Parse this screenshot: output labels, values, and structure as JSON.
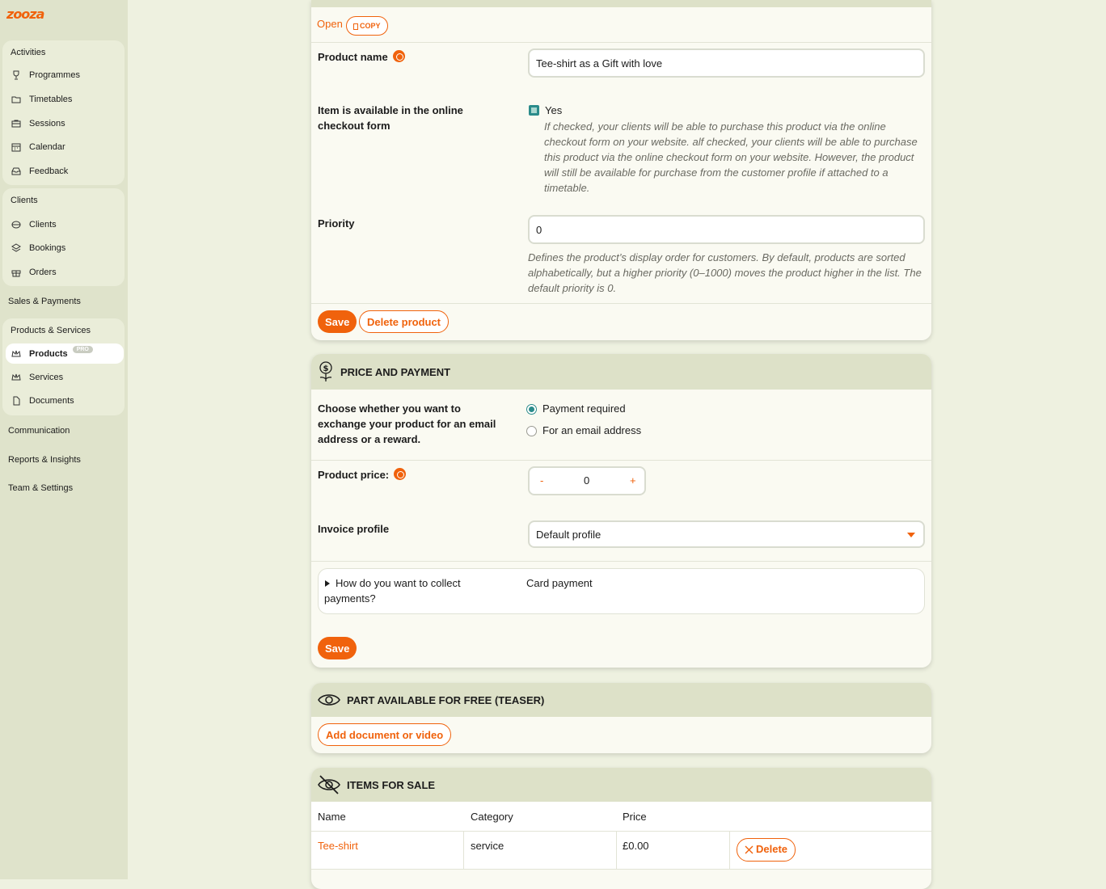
{
  "brand": {
    "logo_text": "zooza",
    "accent": "#f0620c"
  },
  "sidebar": {
    "groups": [
      {
        "heading": "Activities",
        "items": [
          {
            "label": "Programmes",
            "icon": "trophy-icon"
          },
          {
            "label": "Timetables",
            "icon": "folder-icon"
          },
          {
            "label": "Sessions",
            "icon": "briefcase-icon"
          },
          {
            "label": "Calendar",
            "icon": "calendar-icon"
          },
          {
            "label": "Feedback",
            "icon": "inbox-icon"
          }
        ]
      },
      {
        "heading": "Clients",
        "items": [
          {
            "label": "Clients",
            "icon": "users-icon"
          },
          {
            "label": "Bookings",
            "icon": "layers-icon"
          },
          {
            "label": "Orders",
            "icon": "gift-icon"
          }
        ]
      },
      {
        "heading": "Products & Services",
        "items": [
          {
            "label": "Products",
            "icon": "crown-icon",
            "active": true,
            "badge": "PRO"
          },
          {
            "label": "Services",
            "icon": "crown-icon"
          },
          {
            "label": "Documents",
            "icon": "document-icon"
          }
        ]
      }
    ],
    "standalone": [
      "Sales & Payments",
      "Communication",
      "Reports & Insights",
      "Team & Settings"
    ]
  },
  "product_card": {
    "open_label": "Open",
    "copy_label": "COPY",
    "product_name_label": "Product name",
    "product_name_value": "Tee-shirt as a Gift with love",
    "online_label": "Item is available in the online checkout form",
    "online_checked_label": "Yes",
    "online_help": "If checked, your clients will be able to purchase this product via the online checkout form on your website. alf checked, your clients will be able to purchase this product via the online checkout form on your website. However, the product will still be available for purchase from the customer profile if attached to a timetable.",
    "priority_label": "Priority",
    "priority_value": "0",
    "priority_help": "Defines the product’s display order for customers. By default, products are sorted alphabetically, but a higher priority (0–1000) moves the product higher in the list. The default priority is 0.",
    "save_label": "Save",
    "delete_label": "Delete product"
  },
  "price_card": {
    "title": "PRICE AND PAYMENT",
    "exchange_label": "Choose whether you want to exchange your product for an email address or a reward.",
    "options": [
      "Payment required",
      "For an email address"
    ],
    "selected_option": "Payment required",
    "price_label": "Product price:",
    "price_minus": "-",
    "price_value": "0",
    "price_plus": "+",
    "invoice_label": "Invoice profile",
    "invoice_value": "Default profile",
    "collect_label": "How do you want to collect payments?",
    "collect_value": "Card payment",
    "save_label": "Save"
  },
  "teaser_card": {
    "title": "PART AVAILABLE FOR FREE (TEASER)",
    "add_label": "Add document or video"
  },
  "items_card": {
    "title": "ITEMS FOR SALE",
    "columns": [
      "Name",
      "Category",
      "Price"
    ],
    "rows": [
      {
        "name": "Tee-shirt",
        "category": "service",
        "price": "£0.00",
        "delete_label": "Delete"
      }
    ]
  }
}
